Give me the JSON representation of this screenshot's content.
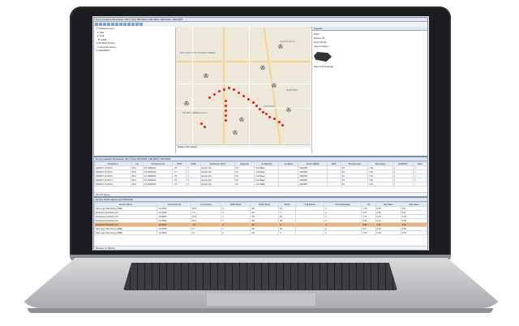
{
  "top_window": {
    "title": "Drug Locations Downtown (NT) ©(1s) NM 0903 | NM 0903 | NM 0903 | NM 0903"
  },
  "tree": {
    "items": [
      {
        "label": "Network Layer"
      },
      {
        "label": "Site"
      },
      {
        "label": "Cell"
      },
      {
        "label": "GSM"
      },
      {
        "label": "Medical Floods"
      },
      {
        "label": "Drug Emisions"
      },
      {
        "label": "ValueBoss"
      }
    ]
  },
  "map": {
    "labels": [
      "THE TRAILS OF POSSE CREEK",
      "PARKWAY",
      "RAVEN CREEK HILLS",
      "WATKINS",
      "WHITE HILLS"
    ],
    "status": "Scale 1:51 meters"
  },
  "legend_panel": {
    "title": "Legend",
    "items": [
      "Sites",
      "Device ID",
      "Drive Route",
      "Last Location"
    ],
    "note": "Map Grid Settings"
  },
  "mid_window": {
    "title": "Drug Locations Downtown (NT) ©(1s) NM 0903 | NM 0903 | NM 0903",
    "columns": [
      "Timestamp",
      "Lat",
      "Connection ID",
      "RSSI",
      "SINR",
      "Cell/Sector (PCI)",
      "Regional",
      "Conditional",
      "Cn Merit",
      "Sector (BSID)",
      "BSIC",
      "Physical Cell",
      "Technology",
      "EARFCN",
      "MCC"
    ],
    "rows": [
      [
        "2/9/2017 10:22:10",
        "30.4",
        "1/1 0060100",
        "-78",
        "5",
        "Sector 2/A",
        "Ch",
        "Unit Base",
        "",
        "1/9/1967",
        "",
        "49",
        "LTE",
        "1",
        "1"
      ],
      [
        "2/9/2017 10:22:13",
        "30.4",
        "1/1 0060100",
        "-77",
        "4",
        "Sector 2/A",
        "Ch",
        "Unit Base",
        "",
        "1/9/1967",
        "",
        "49",
        "LTE",
        "1",
        "1"
      ],
      [
        "2/9/2017 10:22:15",
        "30.4",
        "1/1 0060100",
        "-76",
        "4",
        "Sector 2/A",
        "Ch",
        "Unit Base",
        "",
        "1/9/1967",
        "",
        "49",
        "LTE",
        "1",
        "1"
      ],
      [
        "2/9/2017 10:22:17",
        "30.4",
        "1/1 0060100",
        "-75",
        "3",
        "Sector 2/A",
        "Ch",
        "Unit Base",
        "",
        "1/9/1967",
        "",
        "49",
        "LTE",
        "1",
        "1"
      ],
      [
        "2/9/2017 10:22:19",
        "30.4",
        "1/1 0060100",
        "-79",
        "5",
        "Sector 2/A",
        "Ch",
        "Unit Base",
        "",
        "1/9/1967",
        "",
        "49",
        "LTE",
        "1",
        "1"
      ]
    ],
    "status": "21 of 9 types"
  },
  "bottom_window": {
    "title": "Device Performance per Individual",
    "columns": [
      "Device Name",
      "Connection ID",
      "Connections",
      "SINR Worst",
      "RSSI Worst",
      "Drops",
      "Call Setups",
      "Normal Release",
      "Vol",
      "Avg Value",
      "Max Value"
    ],
    "rows": [
      [
        "Sam Lygro NH Aiming (IMEI)",
        "1/1 0000",
        "15.5",
        "3",
        "-08",
        "15",
        "",
        "2",
        "1.16",
        "0.38",
        "0.11"
      ],
      [
        "Enterprise Solutions Ltd",
        "1/1 0000",
        "7.5",
        "3",
        "-08",
        "0",
        "",
        "4",
        "1.07",
        "0.48",
        "0.11"
      ],
      [
        "Enterprise Solutions Ltd",
        "1/1 0000",
        "10.8",
        "3",
        "-08",
        "50",
        "",
        "2",
        "1.11",
        "0.23",
        "0.10"
      ],
      [
        "Enterprise Solutions Ltd",
        "1/1 0000",
        "29.9",
        "3",
        "-08",
        "48",
        "",
        "2",
        "0.48",
        "0.16",
        "0.06"
      ],
      [
        "Enterprise Solutions Ltd",
        "1/1 0000",
        "7.8",
        "3",
        "-08",
        "0",
        "",
        "4",
        "0.85",
        "0.11",
        "0.11"
      ],
      [
        "Sam Lygro NH Aiming (IMEI)",
        "1/1 0000",
        "6.7",
        "2",
        "-08",
        "20",
        "",
        "2",
        "0.8",
        "0.15",
        "0.06"
      ],
      [
        "Sam Lygro NH Aiming (IMEI)",
        "1/1 0000",
        "4.7",
        "2",
        "-08",
        "0",
        "",
        "4",
        "0.58",
        "0.16",
        "0.03"
      ]
    ],
    "highlight_row": 4,
    "status": "8 Rows (1 shown)"
  }
}
